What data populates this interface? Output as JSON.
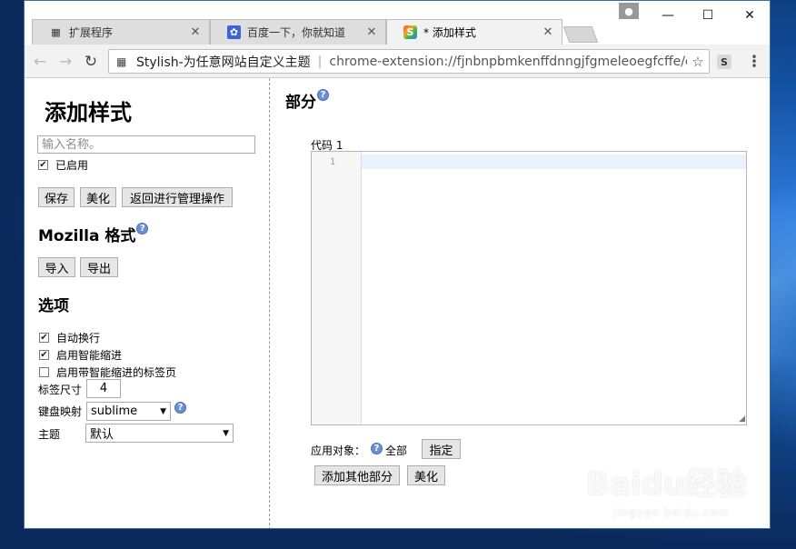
{
  "tabs": [
    {
      "label": "扩展程序",
      "icon": "puzzle-icon"
    },
    {
      "label": "百度一下，你就知道",
      "icon": "baidu-paw-icon"
    },
    {
      "label": "* 添加样式",
      "icon": "stylish-icon"
    }
  ],
  "address": {
    "ext_name": "Stylish-为任意网站自定义主题",
    "url": "chrome-extension://fjnbnpbmkenffdnngjfgmeleoegfcffe/ec"
  },
  "sidebar": {
    "title": "添加样式",
    "name_placeholder": "输入名称。",
    "enabled_label": "已启用",
    "buttons": {
      "save": "保存",
      "beautify": "美化",
      "back": "返回进行管理操作"
    },
    "mozilla_heading": "Mozilla 格式",
    "import_label": "导入",
    "export_label": "导出",
    "options_heading": "选项",
    "options": [
      {
        "label": "自动换行",
        "checked": true
      },
      {
        "label": "启用智能缩进",
        "checked": true
      },
      {
        "label": "启用带智能缩进的标签页",
        "checked": false
      }
    ],
    "tab_size_label": "标签尺寸",
    "tab_size_value": "4",
    "keymap_label": "键盘映射",
    "keymap_value": "sublime",
    "theme_label": "主题",
    "theme_value": "默认"
  },
  "main": {
    "section_heading": "部分",
    "code_label": "代码 1",
    "line_number": "1",
    "applies_label": "应用对象：",
    "applies_value": "全部",
    "specify_button": "指定",
    "add_section_button": "添加其他部分",
    "beautify_button": "美化"
  },
  "watermark": {
    "text": "Baidu经验",
    "sub": "jingyan.baidu.com"
  },
  "colors": {
    "accent": "#6c8fd1",
    "active_line": "#e8f2ff"
  }
}
